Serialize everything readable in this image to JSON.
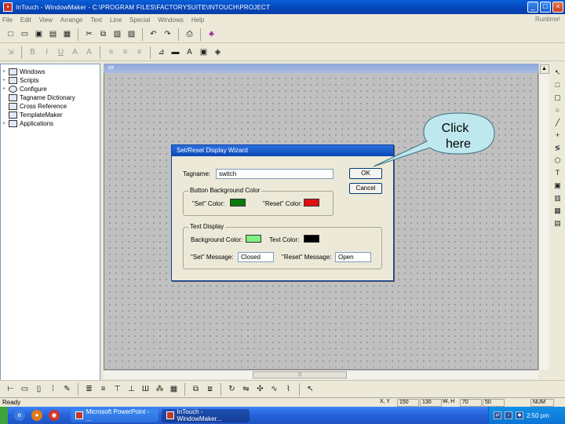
{
  "window": {
    "title": "InTouch - WindowMaker - C:\\PROGRAM FILES\\FACTORYSUITE\\INTOUCH\\PROJECT",
    "controls": {
      "minimize": "_",
      "maximize": "□",
      "close": "×"
    }
  },
  "menubar": {
    "items": [
      "File",
      "Edit",
      "View",
      "Arrange",
      "Text",
      "Line",
      "Special",
      "Windows",
      "Help"
    ],
    "runtime": "Runtime!"
  },
  "tree": {
    "items": [
      {
        "label": "Windows",
        "expander": "+",
        "icon": "window-icon"
      },
      {
        "label": "Scripts",
        "expander": "+",
        "icon": "scripts-icon"
      },
      {
        "label": "Configure",
        "expander": "+",
        "icon": "gear-icon"
      },
      {
        "label": "Tagname Dictionary",
        "expander": "",
        "icon": "dictionary-icon"
      },
      {
        "label": "Cross Reference",
        "expander": "",
        "icon": "cross-ref-icon"
      },
      {
        "label": "TemplateMaker",
        "expander": "",
        "icon": "template-icon"
      },
      {
        "label": "Applications",
        "expander": "+",
        "icon": "applications-icon"
      }
    ]
  },
  "canvas": {
    "caption": "sir"
  },
  "dialog": {
    "title": "Set/Reset Display Wizard",
    "tagname_label": "Tagname:",
    "tagname_value": "switch",
    "ok_label": "OK",
    "cancel_label": "Cancel",
    "button_bg_group": "Button Background Color",
    "set_color_label": "\"Set\" Color:",
    "reset_color_label": "\"Reset\" Color:",
    "text_display_group": "Text Display",
    "bg_color_label": "Background Color:",
    "text_color_label": "Text Color:",
    "set_message_label": "\"Set\" Message:",
    "set_message_value": "Closed",
    "reset_message_label": "\"Reset\" Message:",
    "reset_message_value": "Open",
    "colors": {
      "set": "#0a7a0a",
      "reset": "#e01010",
      "background": "#80f080",
      "text": "#000000"
    }
  },
  "callout": {
    "line1": "Click",
    "line2": "here"
  },
  "status": {
    "ready": "Ready",
    "xy_label": "X, Y",
    "x": "150",
    "y": "130",
    "wh_label": "W, H",
    "w": "70",
    "h": "50",
    "num": "NUM"
  },
  "taskbar": {
    "tasks": [
      {
        "label": "Microsoft PowerPoint - ..."
      },
      {
        "label": "InTouch - WindowMaker..."
      }
    ],
    "tray": {
      "clock": "2:50 pm"
    }
  }
}
